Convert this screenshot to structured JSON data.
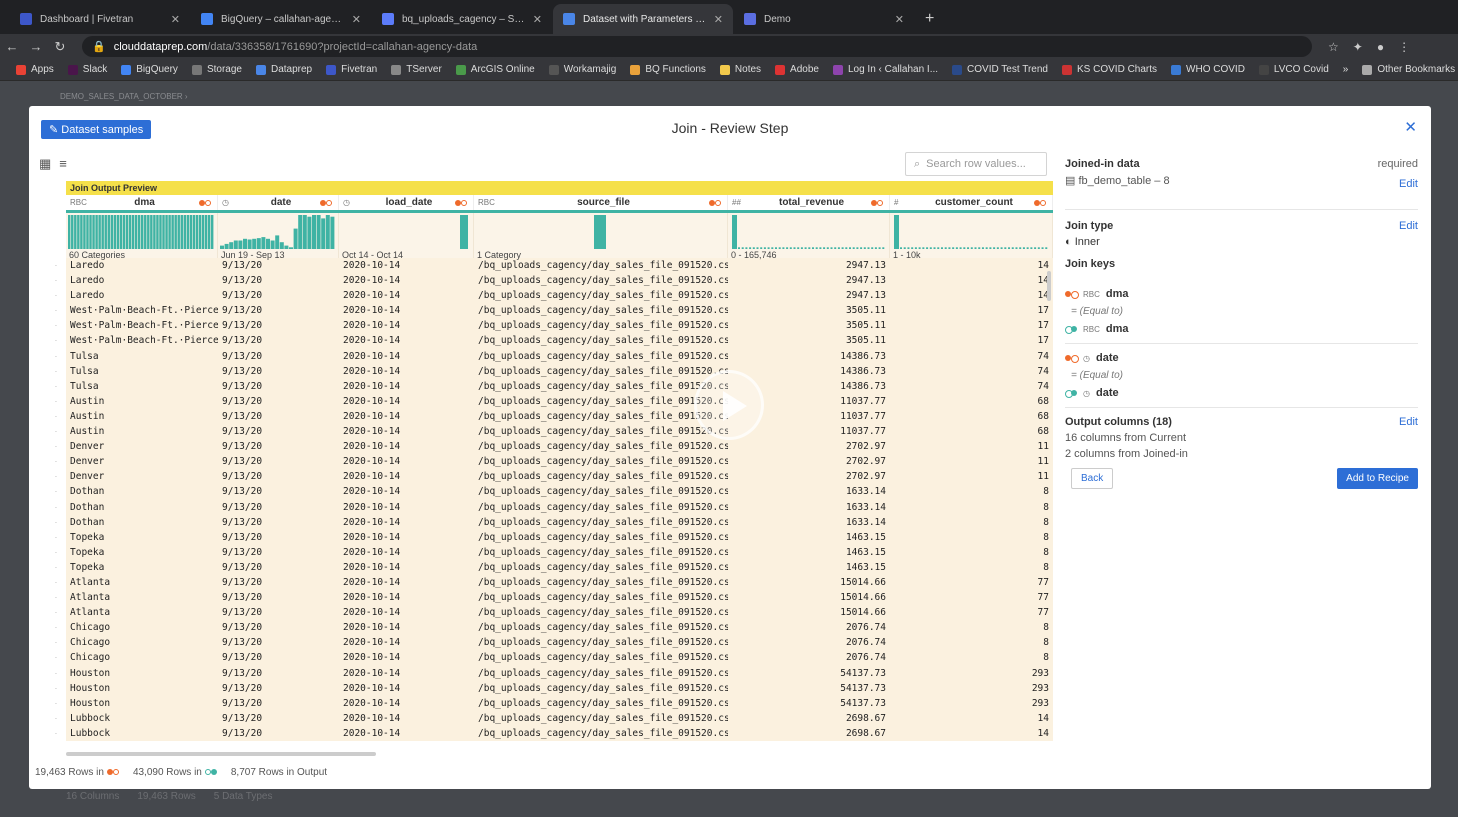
{
  "tabs": [
    {
      "title": "Dashboard | Fivetran",
      "color": "#3d57c9",
      "active": false
    },
    {
      "title": "BigQuery – callahan-agency-d",
      "color": "#4285f4",
      "active": false
    },
    {
      "title": "bq_uploads_cagency – Storag",
      "color": "#5c7cfa",
      "active": false
    },
    {
      "title": "Dataset with Parameters – 60",
      "color": "#4a86e8",
      "active": true
    },
    {
      "title": "Demo",
      "color": "#5b6ee1",
      "active": false
    }
  ],
  "url": {
    "domain": "clouddataprep.com",
    "path": "/data/336358/1761690?projectId=callahan-agency-data"
  },
  "bookmarks": [
    "Apps",
    "Slack",
    "BigQuery",
    "Storage",
    "Dataprep",
    "Fivetran",
    "TServer",
    "ArcGIS Online",
    "Workamajig",
    "BQ Functions",
    "Notes",
    "Adobe",
    "Log In ‹ Callahan I...",
    "COVID Test Trend",
    "KS COVID Charts",
    "WHO COVID",
    "LVCO Covid"
  ],
  "bookmarks_more": "»",
  "other_bookmarks": "Other Bookmarks",
  "background": {
    "crumb": "DEMO_SALES_DATA_OCTOBER ›",
    "foot": [
      "16 Columns",
      "19,463 Rows",
      "5 Data Types"
    ]
  },
  "modal": {
    "title": "Join - Review Step",
    "dataset_button": "Dataset samples",
    "search_placeholder": "Search row values...",
    "banner": "Join Output Preview",
    "columns": [
      {
        "type": "RBC",
        "name": "dma",
        "range": "60 Categories",
        "align": "l"
      },
      {
        "type": "◷",
        "name": "date",
        "range": "Jun 19 - Sep 13",
        "align": "l"
      },
      {
        "type": "◷",
        "name": "load_date",
        "range": "Oct 14 - Oct 14",
        "align": "l"
      },
      {
        "type": "RBC",
        "name": "source_file",
        "range": "1 Category",
        "align": "l"
      },
      {
        "type": "##",
        "name": "total_revenue",
        "range": "0 - 165,746",
        "align": "r"
      },
      {
        "type": "#",
        "name": "customer_count",
        "range": "1 - 10k",
        "align": "r"
      }
    ],
    "rows": [
      [
        "Laredo",
        "9/13/20",
        "2020-10-14",
        "/bq_uploads_cagency/day_sales_file_091520.csv",
        "2947.13",
        "14"
      ],
      [
        "Laredo",
        "9/13/20",
        "2020-10-14",
        "/bq_uploads_cagency/day_sales_file_091520.csv",
        "2947.13",
        "14"
      ],
      [
        "Laredo",
        "9/13/20",
        "2020-10-14",
        "/bq_uploads_cagency/day_sales_file_091520.csv",
        "2947.13",
        "14"
      ],
      [
        "West·Palm·Beach-Ft.·Pierce",
        "9/13/20",
        "2020-10-14",
        "/bq_uploads_cagency/day_sales_file_091520.csv",
        "3505.11",
        "17"
      ],
      [
        "West·Palm·Beach-Ft.·Pierce",
        "9/13/20",
        "2020-10-14",
        "/bq_uploads_cagency/day_sales_file_091520.csv",
        "3505.11",
        "17"
      ],
      [
        "West·Palm·Beach-Ft.·Pierce",
        "9/13/20",
        "2020-10-14",
        "/bq_uploads_cagency/day_sales_file_091520.csv",
        "3505.11",
        "17"
      ],
      [
        "Tulsa",
        "9/13/20",
        "2020-10-14",
        "/bq_uploads_cagency/day_sales_file_091520.csv",
        "14386.73",
        "74"
      ],
      [
        "Tulsa",
        "9/13/20",
        "2020-10-14",
        "/bq_uploads_cagency/day_sales_file_091520.csv",
        "14386.73",
        "74"
      ],
      [
        "Tulsa",
        "9/13/20",
        "2020-10-14",
        "/bq_uploads_cagency/day_sales_file_091520.csv",
        "14386.73",
        "74"
      ],
      [
        "Austin",
        "9/13/20",
        "2020-10-14",
        "/bq_uploads_cagency/day_sales_file_091520.csv",
        "11037.77",
        "68"
      ],
      [
        "Austin",
        "9/13/20",
        "2020-10-14",
        "/bq_uploads_cagency/day_sales_file_091520.csv",
        "11037.77",
        "68"
      ],
      [
        "Austin",
        "9/13/20",
        "2020-10-14",
        "/bq_uploads_cagency/day_sales_file_091520.csv",
        "11037.77",
        "68"
      ],
      [
        "Denver",
        "9/13/20",
        "2020-10-14",
        "/bq_uploads_cagency/day_sales_file_091520.csv",
        "2702.97",
        "11"
      ],
      [
        "Denver",
        "9/13/20",
        "2020-10-14",
        "/bq_uploads_cagency/day_sales_file_091520.csv",
        "2702.97",
        "11"
      ],
      [
        "Denver",
        "9/13/20",
        "2020-10-14",
        "/bq_uploads_cagency/day_sales_file_091520.csv",
        "2702.97",
        "11"
      ],
      [
        "Dothan",
        "9/13/20",
        "2020-10-14",
        "/bq_uploads_cagency/day_sales_file_091520.csv",
        "1633.14",
        "8"
      ],
      [
        "Dothan",
        "9/13/20",
        "2020-10-14",
        "/bq_uploads_cagency/day_sales_file_091520.csv",
        "1633.14",
        "8"
      ],
      [
        "Dothan",
        "9/13/20",
        "2020-10-14",
        "/bq_uploads_cagency/day_sales_file_091520.csv",
        "1633.14",
        "8"
      ],
      [
        "Topeka",
        "9/13/20",
        "2020-10-14",
        "/bq_uploads_cagency/day_sales_file_091520.csv",
        "1463.15",
        "8"
      ],
      [
        "Topeka",
        "9/13/20",
        "2020-10-14",
        "/bq_uploads_cagency/day_sales_file_091520.csv",
        "1463.15",
        "8"
      ],
      [
        "Topeka",
        "9/13/20",
        "2020-10-14",
        "/bq_uploads_cagency/day_sales_file_091520.csv",
        "1463.15",
        "8"
      ],
      [
        "Atlanta",
        "9/13/20",
        "2020-10-14",
        "/bq_uploads_cagency/day_sales_file_091520.csv",
        "15014.66",
        "77"
      ],
      [
        "Atlanta",
        "9/13/20",
        "2020-10-14",
        "/bq_uploads_cagency/day_sales_file_091520.csv",
        "15014.66",
        "77"
      ],
      [
        "Atlanta",
        "9/13/20",
        "2020-10-14",
        "/bq_uploads_cagency/day_sales_file_091520.csv",
        "15014.66",
        "77"
      ],
      [
        "Chicago",
        "9/13/20",
        "2020-10-14",
        "/bq_uploads_cagency/day_sales_file_091520.csv",
        "2076.74",
        "8"
      ],
      [
        "Chicago",
        "9/13/20",
        "2020-10-14",
        "/bq_uploads_cagency/day_sales_file_091520.csv",
        "2076.74",
        "8"
      ],
      [
        "Chicago",
        "9/13/20",
        "2020-10-14",
        "/bq_uploads_cagency/day_sales_file_091520.csv",
        "2076.74",
        "8"
      ],
      [
        "Houston",
        "9/13/20",
        "2020-10-14",
        "/bq_uploads_cagency/day_sales_file_091520.csv",
        "54137.73",
        "293"
      ],
      [
        "Houston",
        "9/13/20",
        "2020-10-14",
        "/bq_uploads_cagency/day_sales_file_091520.csv",
        "54137.73",
        "293"
      ],
      [
        "Houston",
        "9/13/20",
        "2020-10-14",
        "/bq_uploads_cagency/day_sales_file_091520.csv",
        "54137.73",
        "293"
      ],
      [
        "Lubbock",
        "9/13/20",
        "2020-10-14",
        "/bq_uploads_cagency/day_sales_file_091520.csv",
        "2698.67",
        "14"
      ],
      [
        "Lubbock",
        "9/13/20",
        "2020-10-14",
        "/bq_uploads_cagency/day_sales_file_091520.csv",
        "2698.67",
        "14"
      ]
    ],
    "status": {
      "rows_in_current": "19,463 Rows in",
      "rows_in_joined": "43,090 Rows in",
      "rows_in_output": "8,707 Rows in Output"
    },
    "side": {
      "joined_label": "Joined-in data",
      "required": "required",
      "joined_table": "fb_demo_table – 8",
      "edit": "Edit",
      "join_type_label": "Join type",
      "join_type": "Inner",
      "join_keys_label": "Join keys",
      "keys": [
        {
          "left": "dma",
          "left_type": "RBC",
          "op": "= (Equal to)",
          "right": "dma",
          "right_type": "RBC"
        },
        {
          "left": "date",
          "left_type": "◷",
          "op": "= (Equal to)",
          "right": "date",
          "right_type": "◷"
        }
      ],
      "output_label": "Output columns (18)",
      "output_current": "16 columns from Current",
      "output_joined": "2 columns from Joined-in",
      "back": "Back",
      "add": "Add to Recipe"
    }
  },
  "colors": {
    "accent": "#2d6ed6",
    "current_dot": "#ef6a2b",
    "joined_dot": "#3fb3a4",
    "banner": "#f5e04a"
  }
}
